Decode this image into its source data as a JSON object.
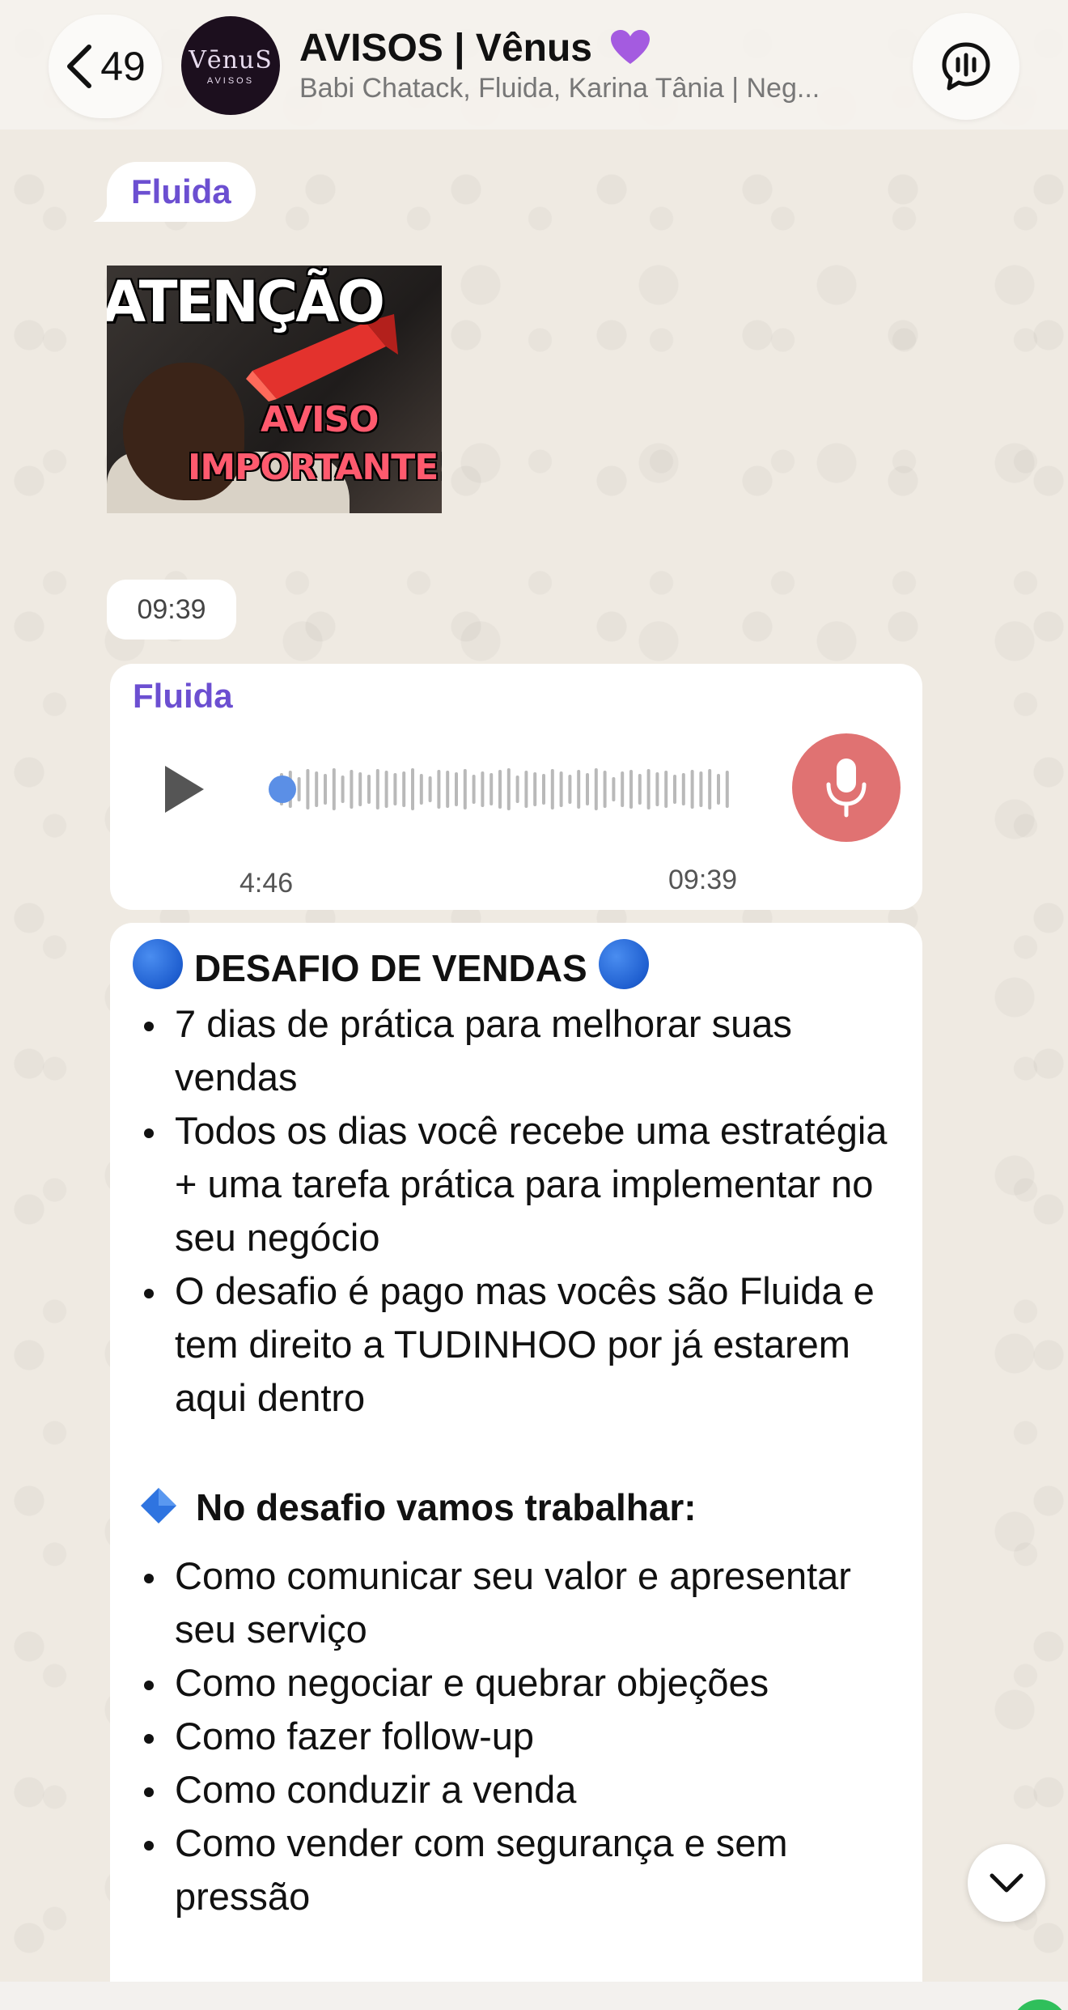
{
  "header": {
    "back_count": "49",
    "avatar_line1": "VēnuS",
    "avatar_line2": "AVISOS",
    "title": "AVISOS | Vênus",
    "subtitle": "Babi Chatack, Fluida, Karina Tânia | Neg..."
  },
  "gif_message": {
    "sender": "Fluida",
    "gif_text_top": "ATENÇÃO",
    "gif_text_line1": "AVISO",
    "gif_text_line2": "IMPORTANTE!!",
    "time": "09:39"
  },
  "audio_message": {
    "sender": "Fluida",
    "duration": "4:46",
    "time": "09:39",
    "progress": 0.0
  },
  "text_message": {
    "heading": "DESAFIO DE VENDAS",
    "list1": [
      "7 dias de prática para melhorar suas vendas",
      "Todos os dias você recebe uma estratégia + uma tarefa prática para implementar no seu negócio",
      "O desafio é pago mas vocês são Fluida e tem direito a TUDINHOO por já estarem aqui dentro"
    ],
    "subheading": "No desafio vamos trabalhar:",
    "list2": [
      "Como comunicar seu valor e apresentar seu serviço",
      "Como negociar e quebrar objeções",
      "Como fazer follow-up",
      "Como conduzir a venda",
      "Como vender com segurança e sem pressão"
    ]
  },
  "colors": {
    "sender_name": "#6c4fd1",
    "mic_button": "#e07272",
    "emoji_blue": "#1f5fd0",
    "chat_background": "#efeae2"
  },
  "icons": {
    "back": "chevron-left-icon",
    "call": "audio-waves-speech-icon",
    "play": "play-icon",
    "mic": "microphone-icon",
    "scroll": "chevron-down-icon",
    "heading_emoji": "blue-circle-icon",
    "subheading_emoji": "blue-diamond-icon",
    "title_emoji": "purple-heart-icon"
  }
}
